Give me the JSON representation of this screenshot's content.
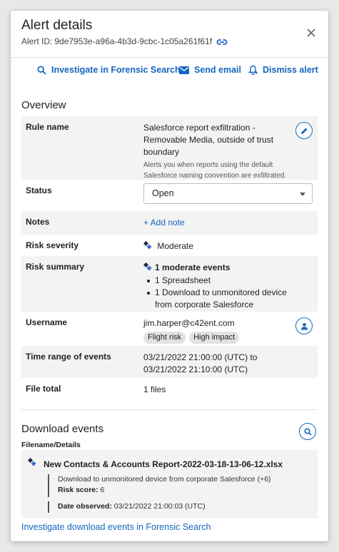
{
  "header": {
    "title": "Alert details",
    "alert_id_label": "Alert ID:",
    "alert_id": "9de7953e-a96a-4b3d-9cbc-1c05a261f61f"
  },
  "actions": {
    "investigate": "Investigate in Forensic Search",
    "send_email": "Send email",
    "dismiss": "Dismiss alert"
  },
  "overview": {
    "title": "Overview",
    "rule_name": {
      "label": "Rule name",
      "value": "Salesforce report exfiltration - Removable Media, outside of trust boundary",
      "description": "Alerts you when reports using the default Salesforce naming convention are exfiltrated."
    },
    "status": {
      "label": "Status",
      "value": "Open"
    },
    "notes": {
      "label": "Notes",
      "add_label": "+ Add note"
    },
    "risk_severity": {
      "label": "Risk severity",
      "value": "Moderate"
    },
    "risk_summary": {
      "label": "Risk summary",
      "headline": "1 moderate events",
      "items": [
        "1 Spreadsheet",
        "1 Download to unmonitored device from corporate Salesforce"
      ]
    },
    "username": {
      "label": "Username",
      "value": "jim.harper@c42ent.com",
      "tags": [
        "Flight risk",
        "High impact"
      ]
    },
    "time_range": {
      "label": "Time range of events",
      "value": "03/21/2022 21:00:00 (UTC) to 03/21/2022 21:10:00 (UTC)"
    },
    "file_total": {
      "label": "File total",
      "value": "1 files"
    }
  },
  "download_events": {
    "title": "Download events",
    "subheading": "Filename/Details",
    "event": {
      "filename": "New Contacts & Accounts Report-2022-03-18-13-06-12.xlsx",
      "description": "Download to unmonitored device from corporate Salesforce (+6)",
      "risk_score_label": "Risk score:",
      "risk_score": "6",
      "date_label": "Date observed:",
      "date": "03/21/2022 21:00:03 (UTC)"
    },
    "footer_link": "Investigate download events in Forensic Search"
  },
  "colors": {
    "accent": "#1565c0",
    "row_shade": "#f3f3f3"
  }
}
